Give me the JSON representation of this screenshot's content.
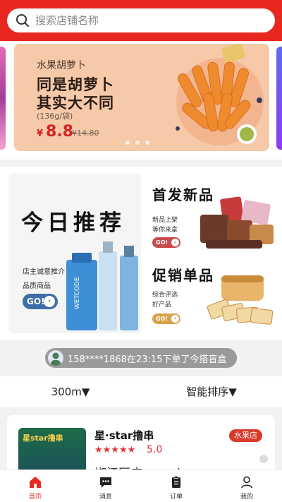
{
  "colors": {
    "brand_red": "#e8281e",
    "price_red": "#d32222",
    "go_blue": "#3d6ea8"
  },
  "search": {
    "placeholder": "搜索店铺名称",
    "icon": "search-icon"
  },
  "banner": {
    "subtitle": "水果胡萝卜",
    "title_line1": "同是胡萝卜",
    "title_line2": "其实大不同",
    "spec": "(136g/袋)",
    "currency": "¥",
    "price": "8.8",
    "old_price": "¥14.80"
  },
  "promo": {
    "today": {
      "title": "今日推荐",
      "desc1": "店主诚意推介",
      "desc2": "品质商品",
      "go": "GO!",
      "product_brand": "WETCODE"
    },
    "new": {
      "title": "首发新品",
      "desc1": "新品上架",
      "desc2": "等你来拿",
      "go": "GO!"
    },
    "sale": {
      "title": "促销单品",
      "desc1": "综合评选",
      "desc2": "好产品",
      "go": "GO!"
    }
  },
  "ticker": {
    "text": "158****1868在23:15下单了今搭盲盒"
  },
  "filter": {
    "distance": "300m▼",
    "sort": "智能排序▼"
  },
  "store": {
    "thumb_sign": "星star撸串",
    "name": "星·star撸串",
    "stars": "★★★★★",
    "rating": "5.0",
    "badge": "水果店",
    "address": "椒江区广querying"
  },
  "tabs": [
    {
      "label": "首页",
      "icon": "home-icon",
      "active": true
    },
    {
      "label": "消息",
      "icon": "message-icon",
      "active": false
    },
    {
      "label": "订单",
      "icon": "order-icon",
      "active": false
    },
    {
      "label": "我的",
      "icon": "user-icon",
      "active": false
    }
  ]
}
